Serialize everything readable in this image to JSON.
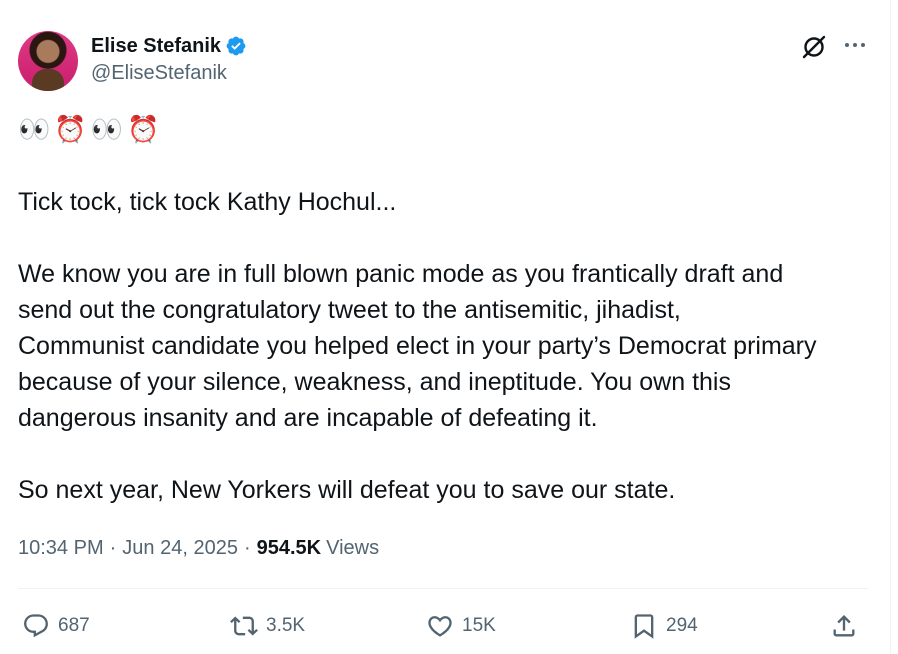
{
  "author": {
    "display_name": "Elise Stefanik",
    "handle": "@EliseStefanik"
  },
  "tweet": {
    "emojis": [
      "👀",
      "⏰",
      "👀",
      "⏰"
    ],
    "paragraphs": [
      "Tick tock, tick tock Kathy Hochul...",
      "We know you are in full blown panic mode as you frantically draft and\nsend out the congratulatory tweet to the antisemitic, jihadist,\nCommunist candidate you helped elect in your party’s Democrat primary\nbecause of your silence, weakness, and ineptitude. You own this\ndangerous insanity and are incapable of defeating it.",
      "So next year, New Yorkers will defeat you to save our state."
    ]
  },
  "meta": {
    "time": "10:34 PM",
    "date": "Jun 24, 2025",
    "views_count": "954.5K",
    "views_label": "Views"
  },
  "actions": {
    "replies": "687",
    "reposts": "3.5K",
    "likes": "15K",
    "bookmarks": "294"
  },
  "colors": {
    "verified": "#1d9bf0",
    "secondary_text": "#536471",
    "primary_text": "#0f1419"
  }
}
